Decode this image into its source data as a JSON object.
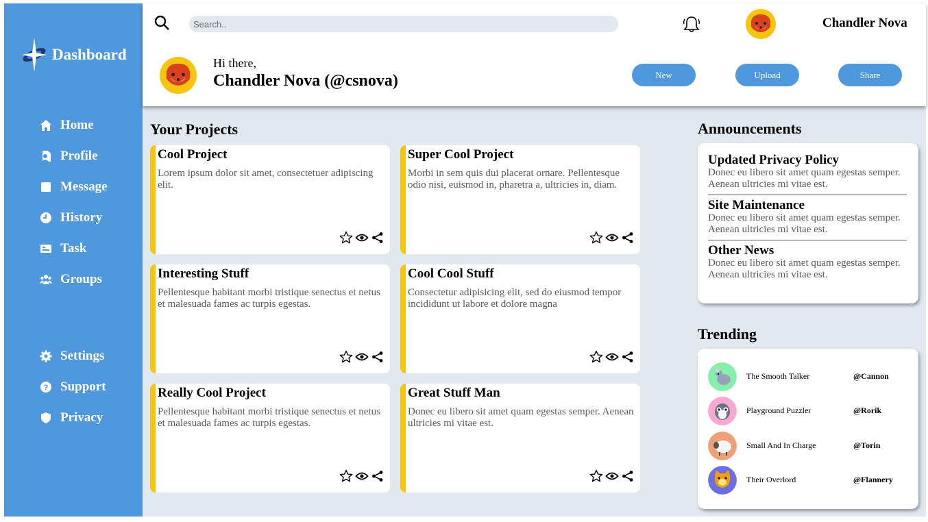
{
  "sidebar": {
    "brand": "Dashboard",
    "nav": [
      {
        "label": "Home",
        "icon": "home-icon"
      },
      {
        "label": "Profile",
        "icon": "profile-icon"
      },
      {
        "label": "Message",
        "icon": "message-icon"
      },
      {
        "label": "History",
        "icon": "history-icon"
      },
      {
        "label": "Task",
        "icon": "task-icon"
      },
      {
        "label": "Groups",
        "icon": "groups-icon"
      }
    ],
    "secondary": [
      {
        "label": "Settings",
        "icon": "gear-icon"
      },
      {
        "label": "Support",
        "icon": "help-icon"
      },
      {
        "label": "Privacy",
        "icon": "shield-icon"
      }
    ]
  },
  "header": {
    "search_placeholder": "Search..",
    "user_name": "Chandler Nova",
    "greeting": "Hi there,",
    "user_handle": "Chandler Nova (@csnova)",
    "buttons": {
      "new": "New",
      "upload": "Upload",
      "share": "Share"
    }
  },
  "projects": {
    "title": "Your Projects",
    "items": [
      {
        "title": "Cool Project",
        "text": "Lorem ipsum dolor sit amet, consectetuer adipiscing elit."
      },
      {
        "title": "Super Cool Project",
        "text": "Morbi in sem quis dui placerat ornare. Pellentesque odio nisi, euismod in, pharetra a, ultricies in, diam."
      },
      {
        "title": "Interesting Stuff",
        "text": "Pellentesque habitant morbi tristique senectus et netus et malesuada fames ac turpis egestas."
      },
      {
        "title": "Cool Cool Stuff",
        "text": "Consectetur adipisicing elit, sed do eiusmod tempor incididunt ut labore et dolore magna"
      },
      {
        "title": "Really Cool Project",
        "text": "Pellentesque habitant morbi tristique senectus et netus et malesuada fames ac turpis egestas."
      },
      {
        "title": "Great Stuff Man",
        "text": "Donec eu libero sit amet quam egestas semper. Aenean ultricies mi vitae est."
      }
    ]
  },
  "announcements": {
    "title": "Announcements",
    "items": [
      {
        "title": "Updated Privacy Policy",
        "text": "Donec eu libero sit amet quam egestas semper. Aenean ultricies mi vitae est."
      },
      {
        "title": "Site Maintenance",
        "text": "Donec eu libero sit amet quam egestas semper. Aenean ultricies mi vitae est."
      },
      {
        "title": "Other News",
        "text": "Donec eu libero sit amet quam egestas semper. Aenean ultricies mi vitae est."
      }
    ]
  },
  "trending": {
    "title": "Trending",
    "items": [
      {
        "name": "The Smooth Talker",
        "handle": "@Cannon",
        "color": "#86efac",
        "icon": "chinchilla-icon"
      },
      {
        "name": "Playground Puzzler",
        "handle": "@Rorik",
        "color": "#f9a8d4",
        "icon": "lemur-icon"
      },
      {
        "name": "Small And In Charge",
        "handle": "@Torin",
        "color": "#fdba74",
        "icon": "sheep-icon"
      },
      {
        "name": "Their Overlord",
        "handle": "@Flannery",
        "color": "#818cf8",
        "icon": "cat-icon"
      }
    ]
  },
  "colors": {
    "accent": "#4f98dd",
    "card_border": "#f7c40f",
    "background": "#e2e8f0"
  }
}
